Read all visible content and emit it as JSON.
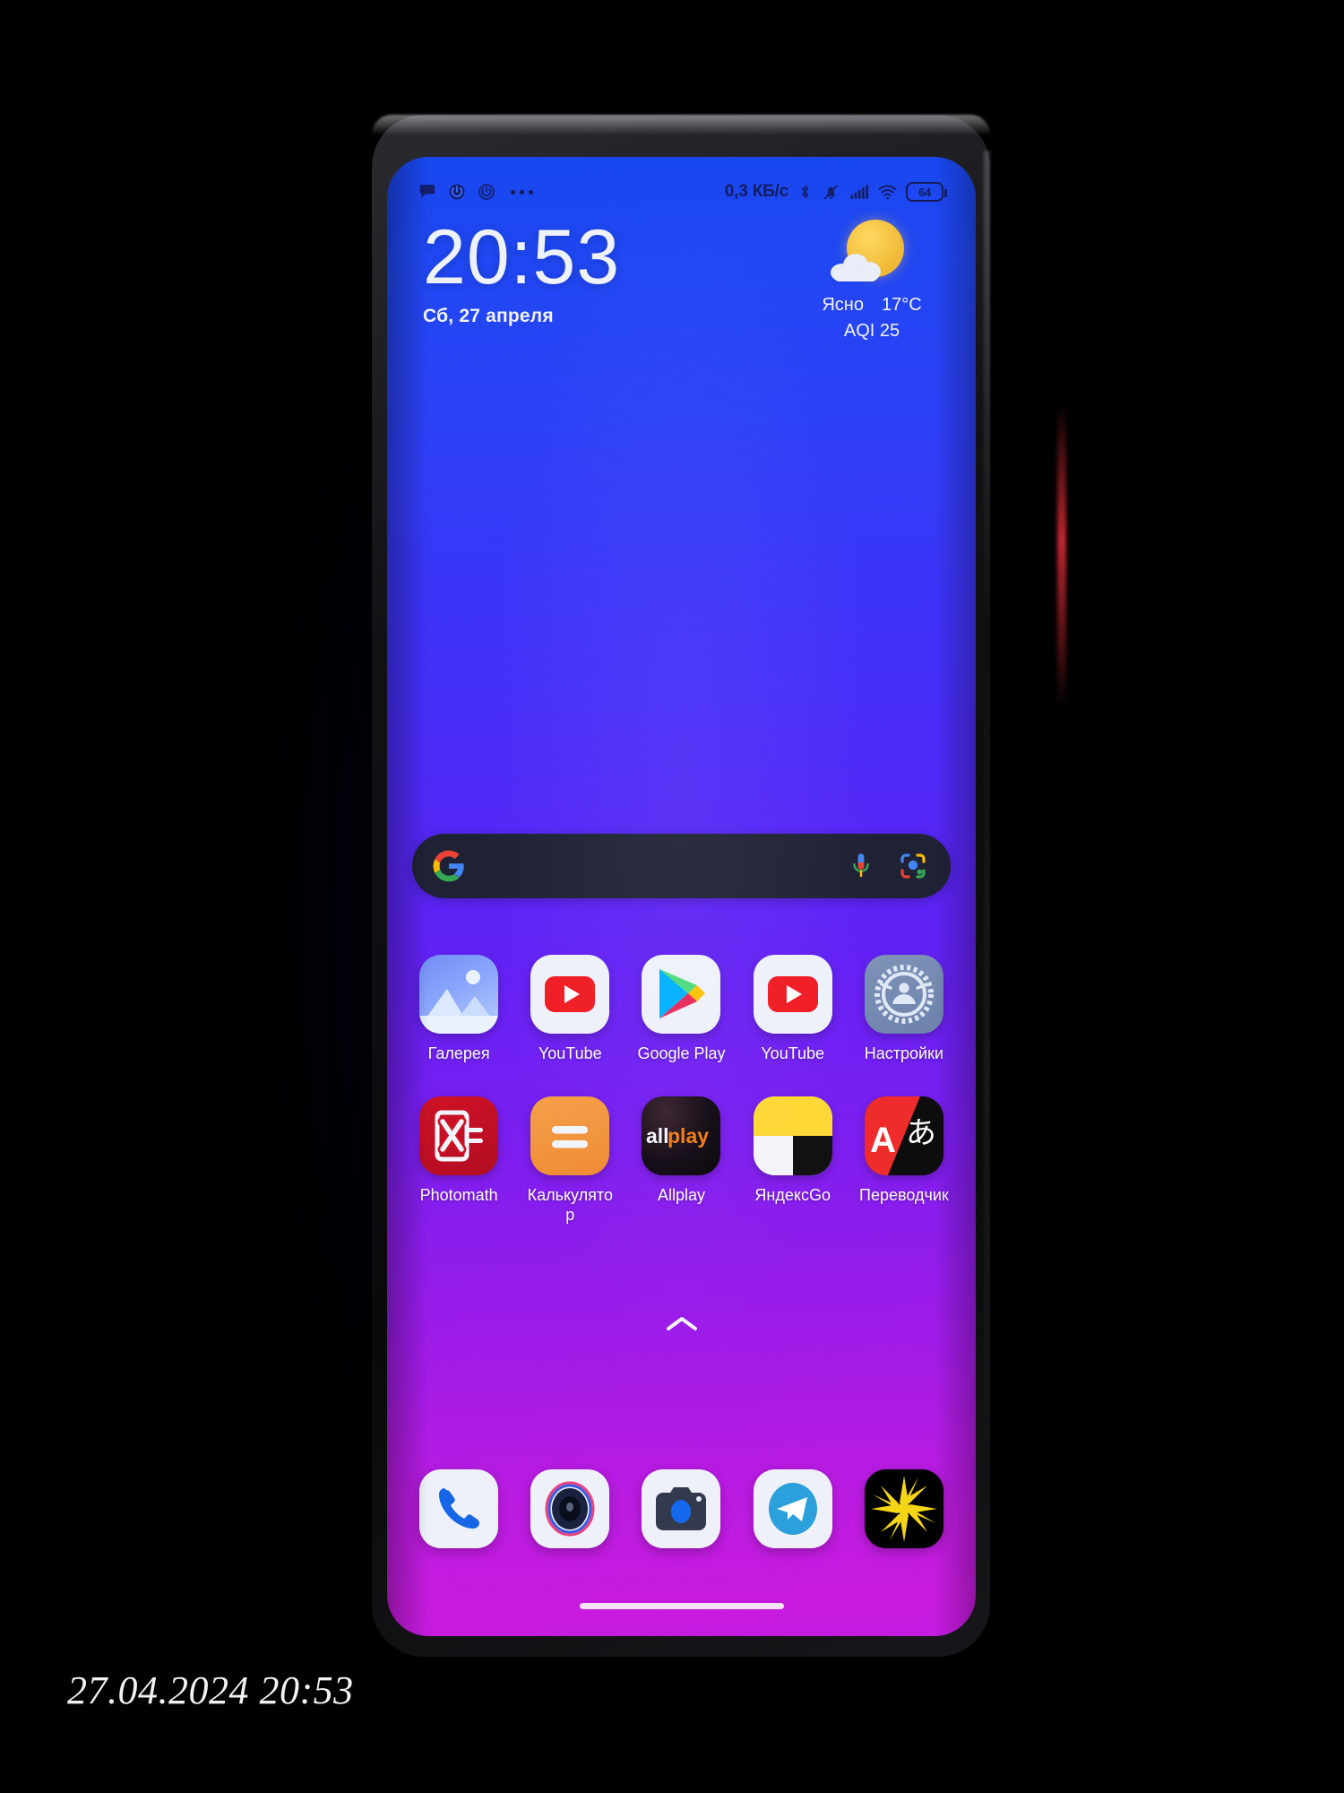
{
  "capture": {
    "timestamp": "27.04.2024 20:53"
  },
  "status_bar": {
    "left_icons": [
      "message-bubble-icon",
      "power-circle-icon",
      "power-circle-outline-icon",
      "more-dots-icon"
    ],
    "network_speed": "0,3 КБ/с",
    "right_icons": [
      "bluetooth-icon",
      "bell-muted-icon",
      "signal-bars-icon",
      "wifi-icon"
    ],
    "battery_level": "64"
  },
  "clock_widget": {
    "time": "20:53",
    "date": "Сб, 27 апреля"
  },
  "weather_widget": {
    "icon": "sun-behind-cloud-icon",
    "condition": "Ясно",
    "temperature": "17°C",
    "aqi": "AQI 25"
  },
  "search_bar": {
    "logo": "google-g-icon",
    "placeholder": "",
    "value": "",
    "mic_icon": "microphone-icon",
    "lens_icon": "google-lens-icon"
  },
  "app_grid": {
    "rows": [
      [
        {
          "label": "Галерея",
          "icon": "gallery-icon"
        },
        {
          "label": "YouTube",
          "icon": "youtube-icon"
        },
        {
          "label": "Google Play",
          "icon": "google-play-icon"
        },
        {
          "label": "YouTube",
          "icon": "youtube-icon"
        },
        {
          "label": "Настройки",
          "icon": "settings-gear-icon"
        }
      ],
      [
        {
          "label": "Photomath",
          "icon": "photomath-icon"
        },
        {
          "label": "Калькулятор",
          "icon": "calculator-icon"
        },
        {
          "label": "Allplay",
          "icon": "allplay-icon"
        },
        {
          "label": "ЯндексGo",
          "icon": "yandex-go-icon"
        },
        {
          "label": "Переводчик",
          "icon": "translate-icon"
        }
      ]
    ]
  },
  "page_indicator": {
    "icon": "chevron-up-icon"
  },
  "dock": {
    "items": [
      {
        "label": "",
        "icon": "phone-icon"
      },
      {
        "label": "",
        "icon": "camera-lens-icon"
      },
      {
        "label": "",
        "icon": "camera-icon"
      },
      {
        "label": "",
        "icon": "telegram-icon"
      },
      {
        "label": "",
        "icon": "starburst-icon"
      }
    ]
  },
  "navigation": {
    "home_bar": "home-indicator"
  },
  "colors": {
    "wallpaper_top": "#1746ef",
    "wallpaper_bottom": "#c41ae0",
    "search_bar_bg": "#1f2235",
    "status_text": "#141c60"
  }
}
